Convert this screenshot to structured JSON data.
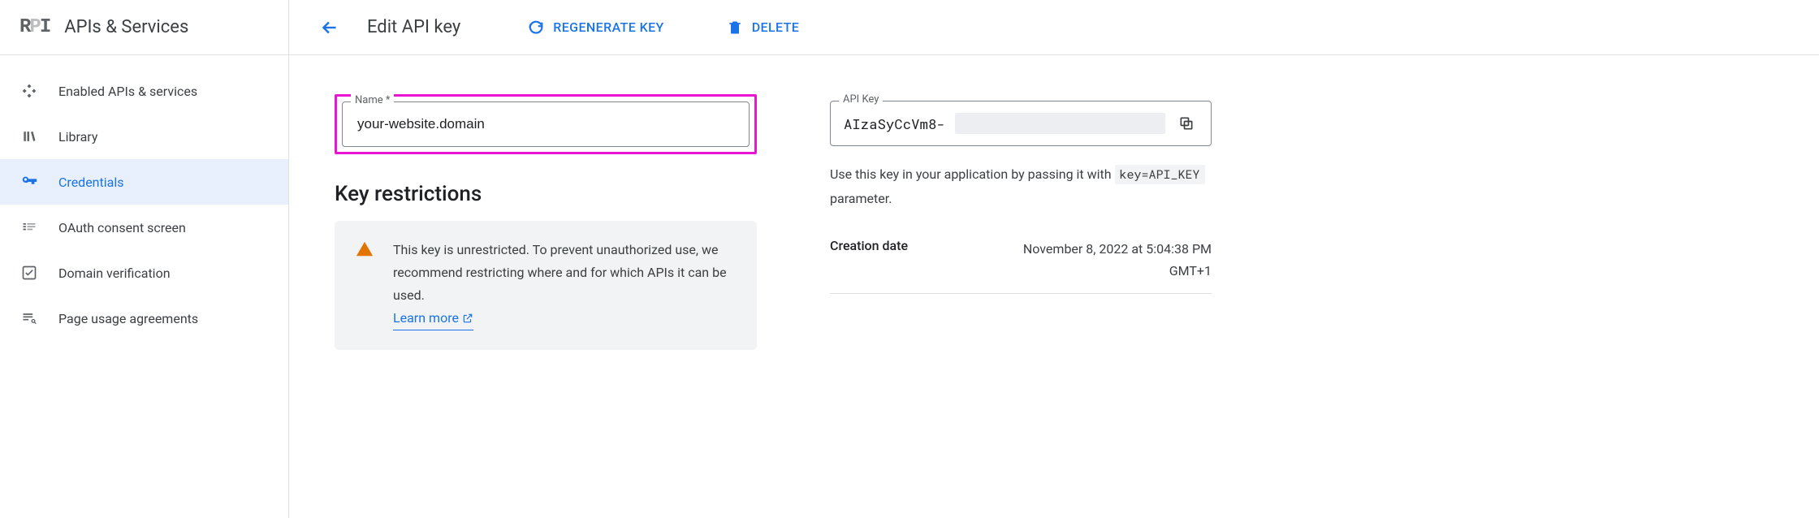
{
  "sidebar": {
    "logo_text": "API",
    "title": "APIs & Services",
    "items": [
      {
        "label": "Enabled APIs & services",
        "icon": "diamond"
      },
      {
        "label": "Library",
        "icon": "library"
      },
      {
        "label": "Credentials",
        "icon": "key"
      },
      {
        "label": "OAuth consent screen",
        "icon": "consent"
      },
      {
        "label": "Domain verification",
        "icon": "check-square"
      },
      {
        "label": "Page usage agreements",
        "icon": "agreements"
      }
    ],
    "active_index": 2
  },
  "header": {
    "page_title": "Edit API key",
    "actions": {
      "regenerate": "REGENERATE KEY",
      "delete": "DELETE"
    }
  },
  "name_field": {
    "label": "Name *",
    "value": "your-website.domain"
  },
  "restrictions": {
    "title": "Key restrictions",
    "warning_text": "This key is unrestricted. To prevent unauthorized use, we recommend restricting where and for which APIs it can be used.",
    "learn_more": "Learn more"
  },
  "api_key_panel": {
    "label": "API Key",
    "value_prefix": "AIzaSyCcVm8-",
    "help_line1": "Use this key in your application by passing it with",
    "help_code": "key=API_KEY",
    "help_line2": " parameter."
  },
  "meta": {
    "creation_label": "Creation date",
    "creation_value": "November 8, 2022 at 5:04:38 PM GMT+1"
  }
}
